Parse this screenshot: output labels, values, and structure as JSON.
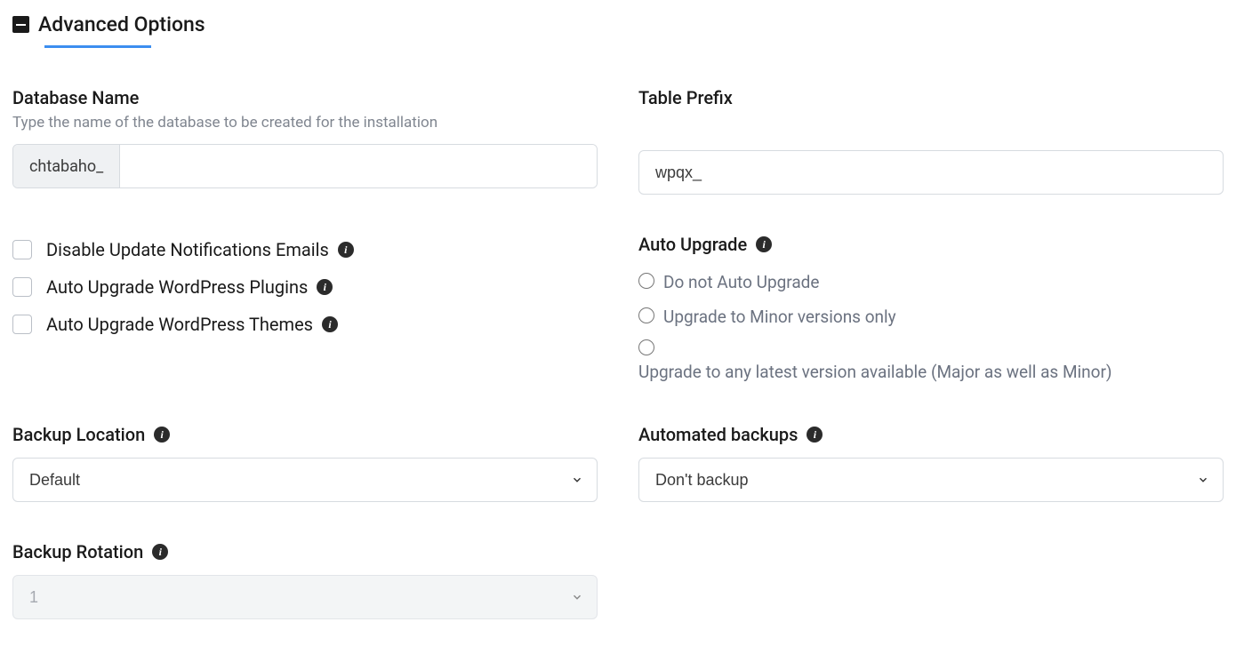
{
  "header": {
    "title": "Advanced Options"
  },
  "database": {
    "label": "Database Name",
    "help": "Type the name of the database to be created for the installation",
    "prefix": "chtabaho_",
    "value": ""
  },
  "tablePrefix": {
    "label": "Table Prefix",
    "value": "wpqx_"
  },
  "checkboxes": {
    "disableUpdateEmails": "Disable Update Notifications Emails",
    "autoUpgradePlugins": "Auto Upgrade WordPress Plugins",
    "autoUpgradeThemes": "Auto Upgrade WordPress Themes"
  },
  "autoUpgrade": {
    "label": "Auto Upgrade",
    "options": {
      "none": "Do not Auto Upgrade",
      "minor": "Upgrade to Minor versions only",
      "major": "Upgrade to any latest version available (Major as well as Minor)"
    }
  },
  "backupLocation": {
    "label": "Backup Location",
    "value": "Default"
  },
  "automatedBackups": {
    "label": "Automated backups",
    "value": "Don't backup"
  },
  "backupRotation": {
    "label": "Backup Rotation",
    "value": "1"
  }
}
